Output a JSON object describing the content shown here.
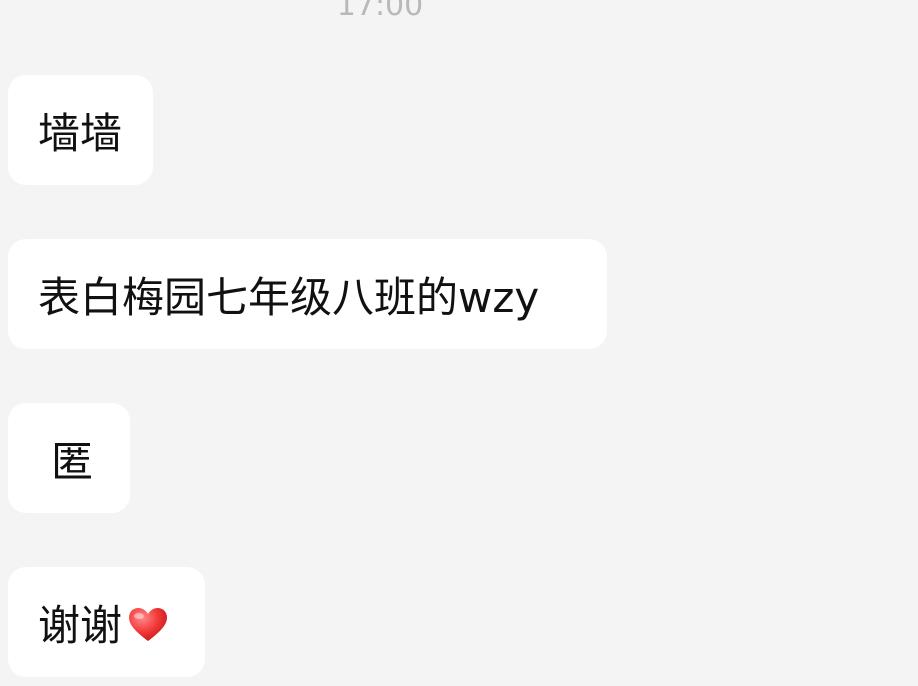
{
  "chat": {
    "timestamp": "17:00",
    "messages": [
      {
        "text": "墙墙"
      },
      {
        "text": "表白梅园七年级八班的wzy"
      },
      {
        "text": "匿"
      },
      {
        "text": "谢谢",
        "emoji": "red-heart"
      }
    ]
  }
}
